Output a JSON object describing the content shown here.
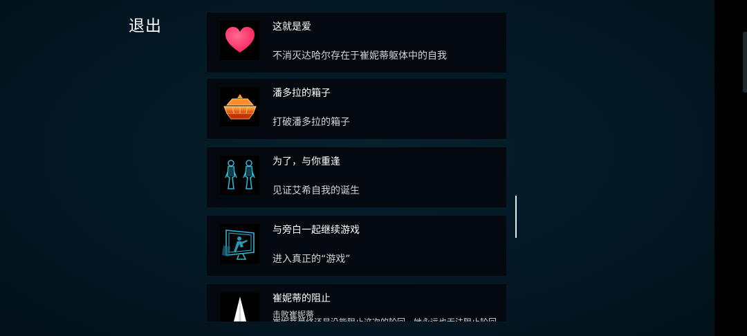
{
  "exit_button": {
    "label": "退出"
  },
  "achievements": [
    {
      "title": "这就是爱",
      "desc": "不消灭达哈尔存在于崔妮蒂躯体中的自我",
      "icon": "heart-icon"
    },
    {
      "title": "潘多拉的箱子",
      "desc": "打破潘多拉的箱子",
      "icon": "pandora-box-icon"
    },
    {
      "title": "为了，与你重逢",
      "desc": "见证艾希自我的诞生",
      "icon": "twin-figures-icon"
    },
    {
      "title": "与旁白一起继续游戏",
      "desc": "进入真正的“游戏”",
      "icon": "monitor-figure-icon"
    },
    {
      "title": "崔妮蒂的阻止",
      "desc": "击败崔妮蒂",
      "desc_extra": "崔妮蒂最终还是没能阻止这次的轮回，她永远也无法阻止轮回",
      "icon": "spire-icon"
    }
  ],
  "colors": {
    "background": "#041824",
    "card": "#03090f",
    "side_bar": "#000000",
    "text": "#ffffff",
    "heart": "#ff2e6a",
    "box": "#ff7a1a",
    "hologram": "#2fb6d6"
  }
}
